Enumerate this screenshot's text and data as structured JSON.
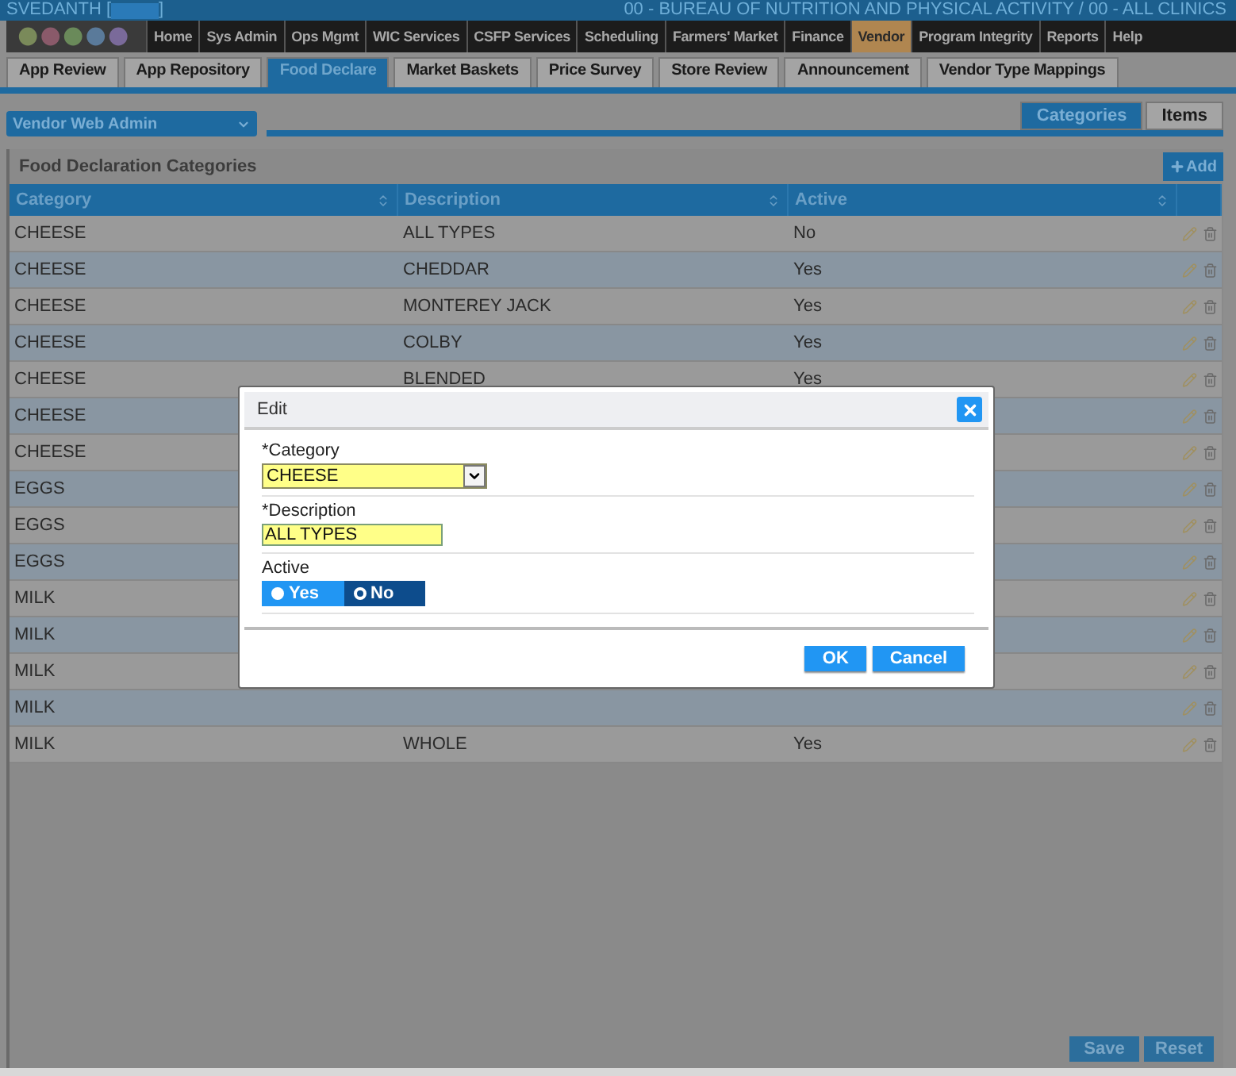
{
  "header": {
    "user": "SVEDANTH [",
    "user_end": "]",
    "agency": "00 - BUREAU OF NUTRITION AND PHYSICAL ACTIVITY / 00 - ALL CLINICS"
  },
  "nav": [
    {
      "label": "Home",
      "selected": false
    },
    {
      "label": "Sys Admin",
      "selected": false
    },
    {
      "label": "Ops Mgmt",
      "selected": false
    },
    {
      "label": "WIC Services",
      "selected": false
    },
    {
      "label": "CSFP Services",
      "selected": false
    },
    {
      "label": "Scheduling",
      "selected": false
    },
    {
      "label": "Farmers' Market",
      "selected": false
    },
    {
      "label": "Finance",
      "selected": false
    },
    {
      "label": "Vendor",
      "selected": true
    },
    {
      "label": "Program Integrity",
      "selected": false
    },
    {
      "label": "Reports",
      "selected": false
    },
    {
      "label": "Help",
      "selected": false
    }
  ],
  "tabs": [
    {
      "label": "App Review",
      "selected": false
    },
    {
      "label": "App Repository",
      "selected": false
    },
    {
      "label": "Food Declare",
      "selected": true
    },
    {
      "label": "Market Baskets",
      "selected": false
    },
    {
      "label": "Price Survey",
      "selected": false
    },
    {
      "label": "Store Review",
      "selected": false
    },
    {
      "label": "Announcement",
      "selected": false
    },
    {
      "label": "Vendor Type Mappings",
      "selected": false
    }
  ],
  "module_select": "Vendor Web Admin",
  "subtabs": [
    {
      "label": "Categories",
      "selected": true
    },
    {
      "label": "Items",
      "selected": false
    }
  ],
  "section": {
    "title": "Food Declaration Categories",
    "add_button": "Add"
  },
  "table": {
    "columns": [
      "Category",
      "Description",
      "Active"
    ],
    "rows": [
      {
        "category": "CHEESE",
        "description": "ALL TYPES",
        "active": "No"
      },
      {
        "category": "CHEESE",
        "description": "CHEDDAR",
        "active": "Yes"
      },
      {
        "category": "CHEESE",
        "description": "MONTEREY JACK",
        "active": "Yes"
      },
      {
        "category": "CHEESE",
        "description": "COLBY",
        "active": "Yes"
      },
      {
        "category": "CHEESE",
        "description": "BLENDED",
        "active": "Yes"
      },
      {
        "category": "CHEESE"
      },
      {
        "category": "CHEESE"
      },
      {
        "category": "EGGS"
      },
      {
        "category": "EGGS"
      },
      {
        "category": "EGGS"
      },
      {
        "category": "MILK"
      },
      {
        "category": "MILK"
      },
      {
        "category": "MILK"
      },
      {
        "category": "MILK"
      },
      {
        "category": "MILK",
        "description": "WHOLE",
        "active": "Yes"
      }
    ]
  },
  "dialog": {
    "title": "Edit",
    "fields": [
      {
        "kind": "select",
        "label": "*Category",
        "value": "CHEESE"
      },
      {
        "kind": "text",
        "label": "*Description",
        "value": "ALL TYPES"
      },
      {
        "kind": "toggle",
        "label": "Active",
        "options": [
          {
            "label": "Yes",
            "selected": false
          },
          {
            "label": "No",
            "selected": true
          }
        ]
      }
    ],
    "buttons": [
      "OK",
      "Cancel"
    ]
  },
  "footer_buttons": [
    "Save",
    "Reset"
  ]
}
